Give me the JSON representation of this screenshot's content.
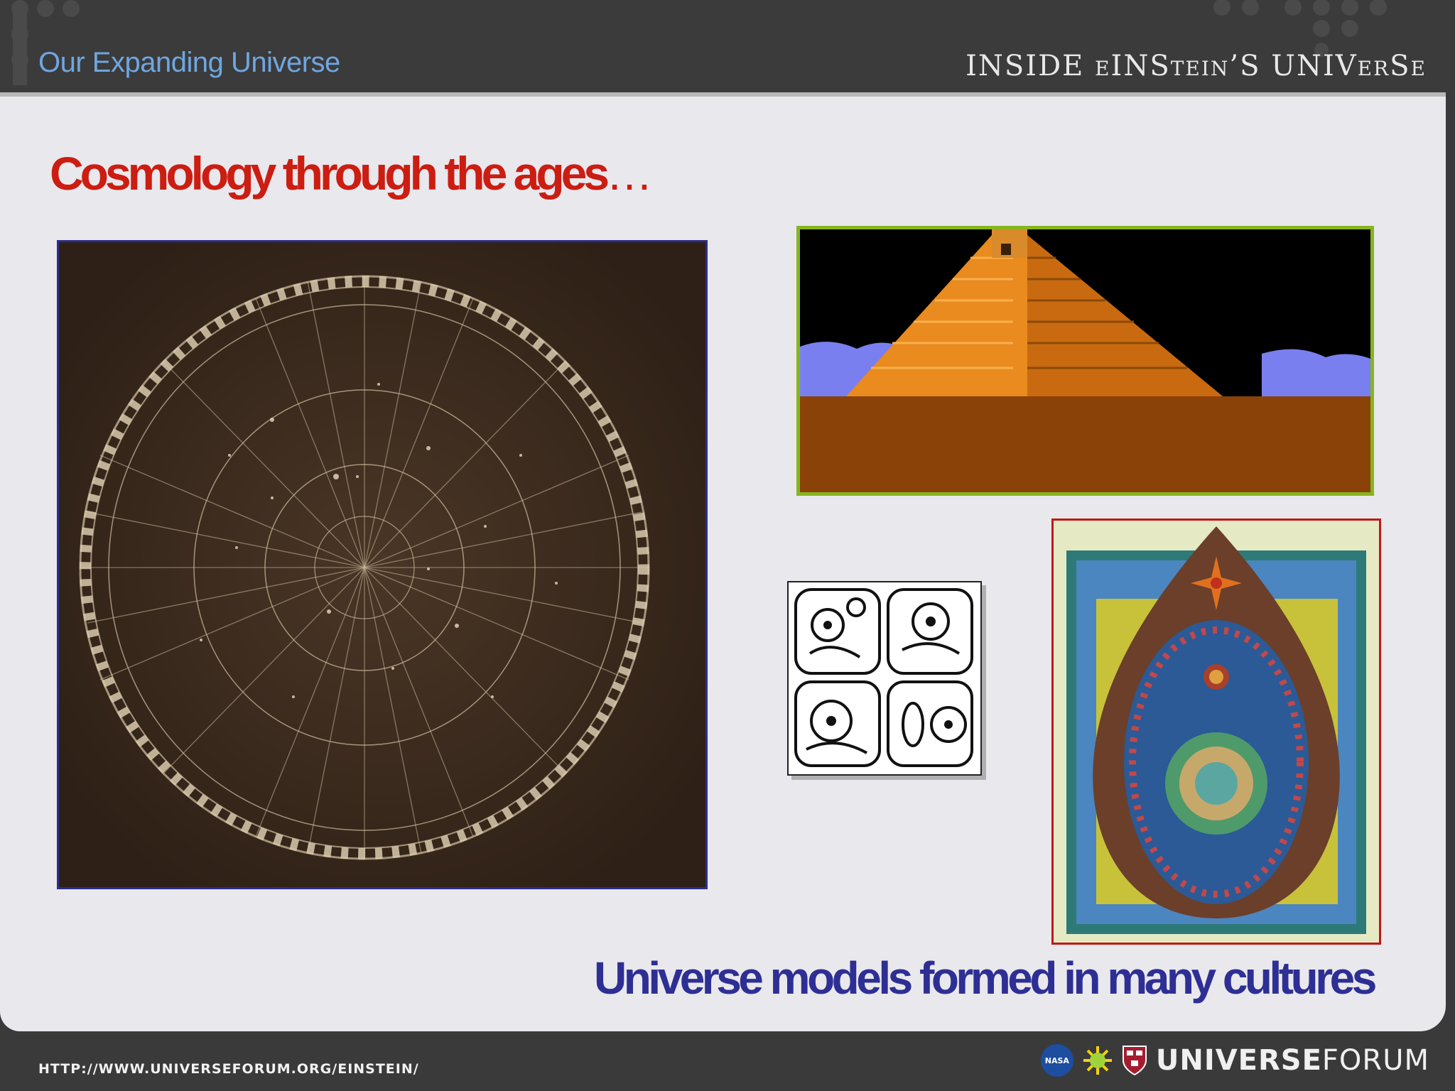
{
  "header": {
    "section_title": "Our Expanding Universe",
    "series_title": "INSIDE eINStein’S UNIVerSe"
  },
  "slide": {
    "title": "Cosmology through the ages",
    "title_suffix": "…",
    "caption": "Universe models formed in many cultures"
  },
  "images": [
    {
      "name": "star-chart"
    },
    {
      "name": "mayan-pyramid"
    },
    {
      "name": "mayan-glyphs"
    },
    {
      "name": "medieval-cosmos"
    }
  ],
  "footer": {
    "url": "HTTP://WWW.UNIVERSEFORUM.ORG/EINSTEIN/",
    "brand_bold": "UNIVERSE",
    "brand_light": "FORUM",
    "nasa_label": "NASA"
  },
  "colors": {
    "title_red": "#cc1d12",
    "caption_blue": "#2e2f94",
    "header_blue": "#6fa6e0",
    "pyramid_border": "#86b51e",
    "cosmos_border": "#c01818",
    "starmap_border": "#2e2d8c"
  }
}
